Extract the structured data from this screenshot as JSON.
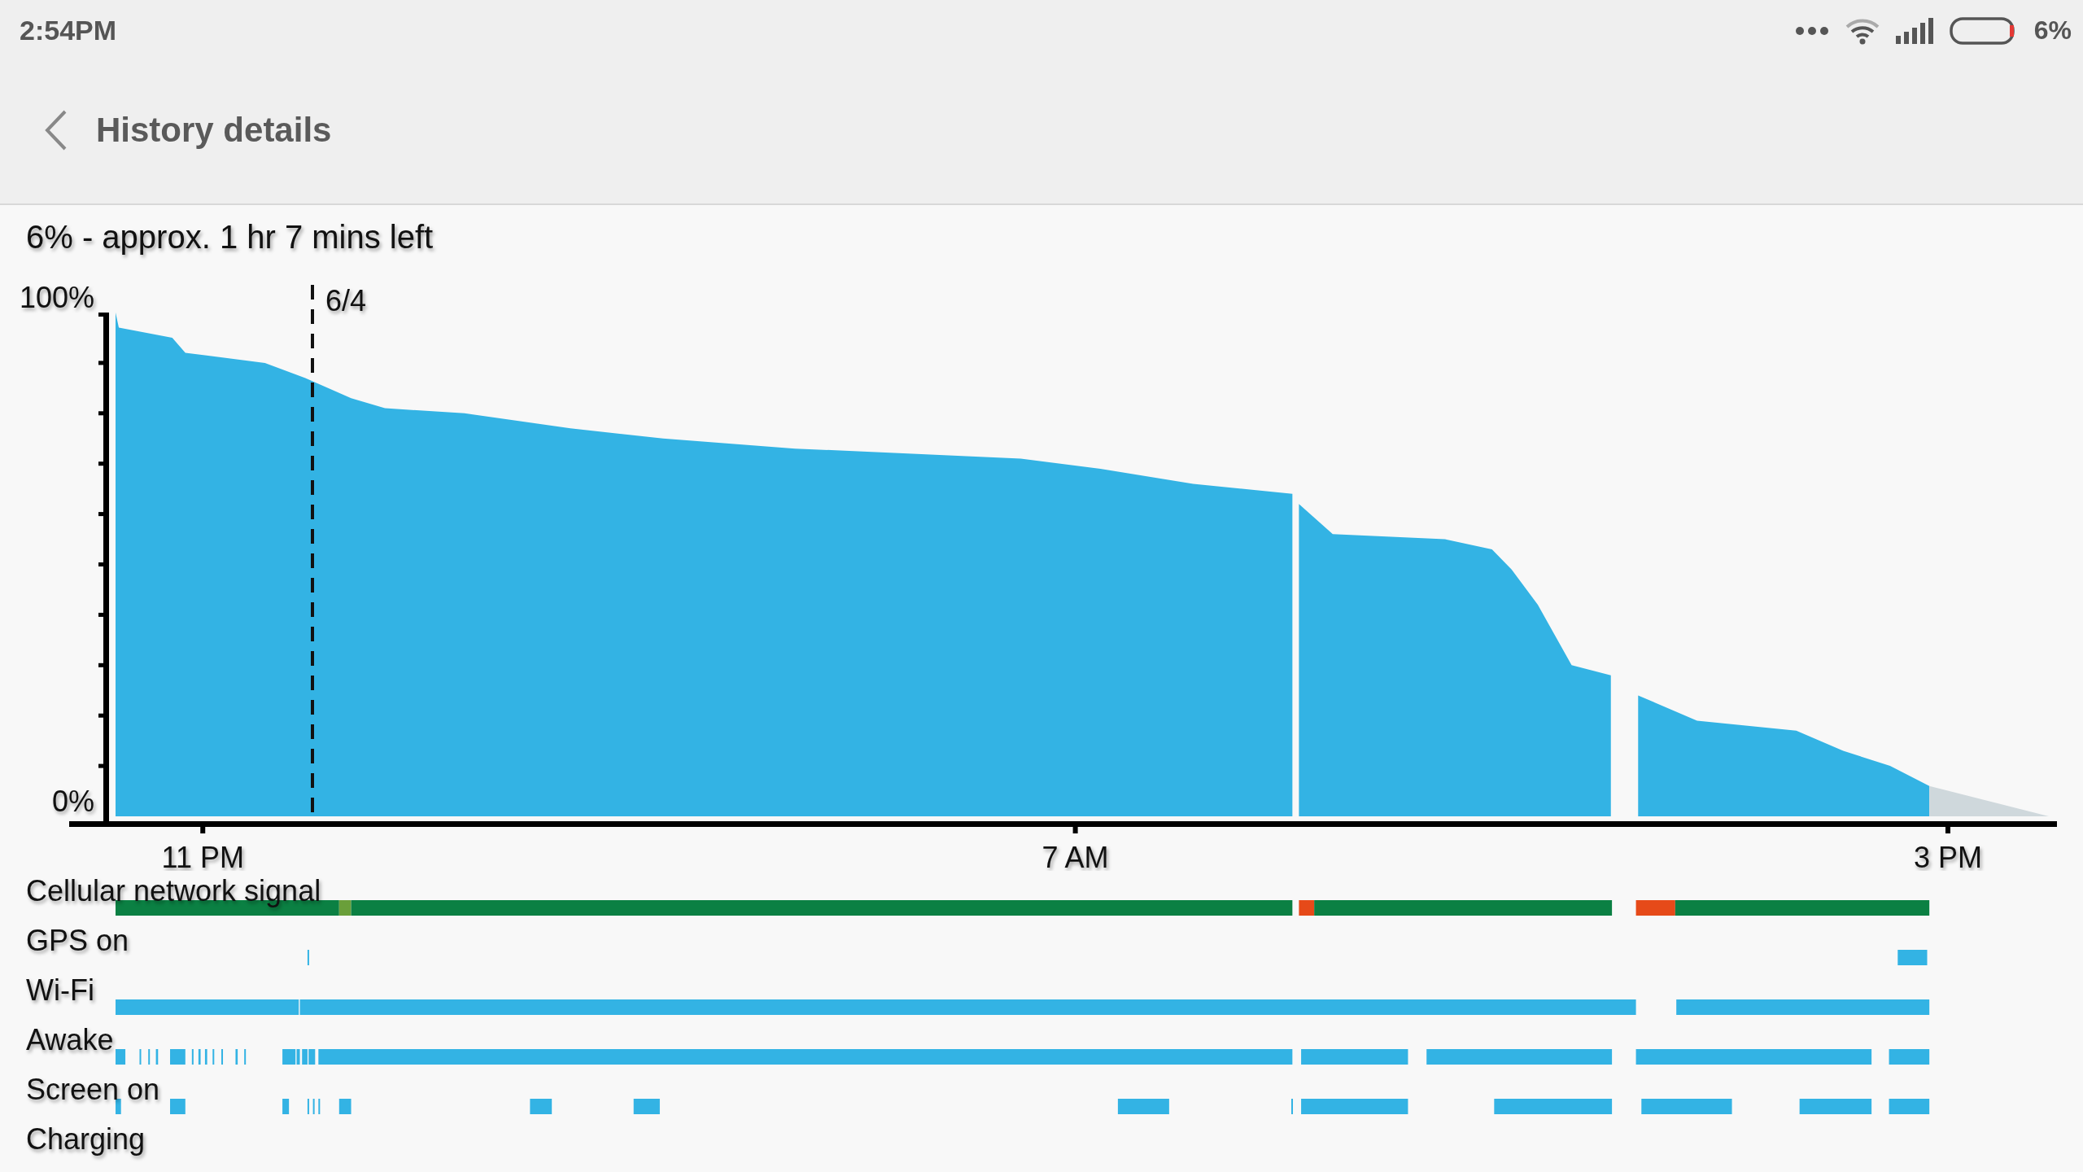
{
  "status_bar": {
    "time": "2:54PM",
    "battery_text": "6%"
  },
  "toolbar": {
    "title": "History details"
  },
  "summary": "6% - approx. 1 hr 7 mins left",
  "battery_graph": {
    "y_labels": [
      "100%",
      "0%"
    ],
    "x_labels": [
      "11 PM",
      "7 AM",
      "3 PM"
    ],
    "date_marker": "6/4"
  },
  "tracks": [
    {
      "label": "Cellular network signal"
    },
    {
      "label": "GPS on"
    },
    {
      "label": "Wi-Fi"
    },
    {
      "label": "Awake"
    },
    {
      "label": "Screen on"
    },
    {
      "label": "Charging"
    }
  ]
}
